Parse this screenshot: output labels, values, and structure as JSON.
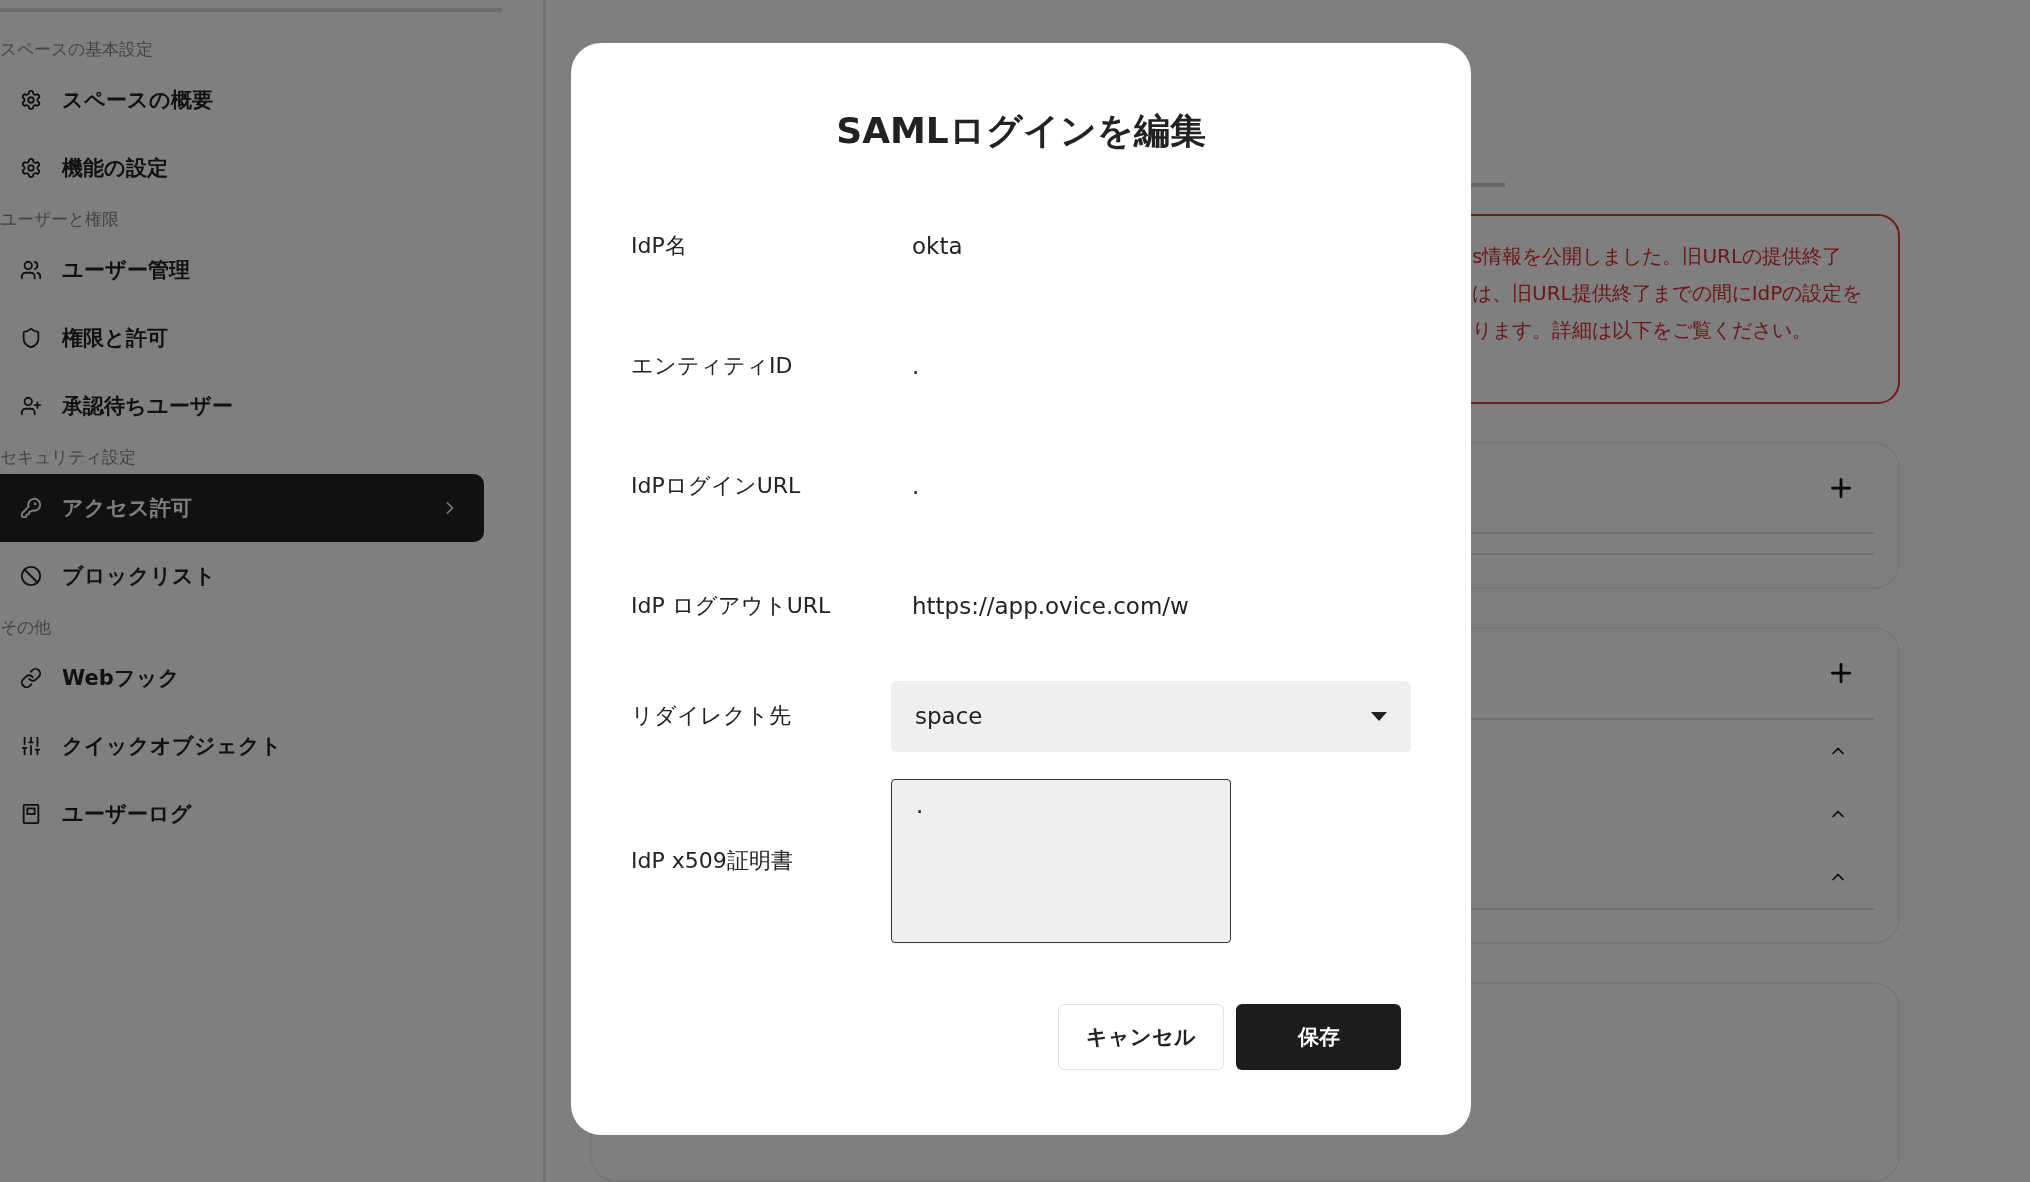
{
  "sidebar": {
    "sections": [
      {
        "heading": "スペースの基本設定",
        "items": [
          {
            "label": "スペースの概要",
            "selected": false
          },
          {
            "label": "機能の設定",
            "selected": false
          }
        ]
      },
      {
        "heading": "ユーザーと権限",
        "items": [
          {
            "label": "ユーザー管理",
            "selected": false
          },
          {
            "label": "権限と許可",
            "selected": false
          },
          {
            "label": "承認待ちユーザー",
            "selected": false
          }
        ]
      },
      {
        "heading": "セキュリティ設定",
        "items": [
          {
            "label": "アクセス許可",
            "selected": true
          },
          {
            "label": "ブロックリスト",
            "selected": false
          }
        ]
      },
      {
        "heading": "その他",
        "items": [
          {
            "label": "Webフック",
            "selected": false
          },
          {
            "label": "クイックオブジェクト",
            "selected": false
          },
          {
            "label": "ユーザーログ",
            "selected": false
          }
        ]
      }
    ]
  },
  "main": {
    "alert": {
      "lines": [
        "s情報を公開しました。旧URLの提供終了",
        "は、旧URL提供終了までの間にIdPの設定を",
        "ります。詳細は以下をご覧ください。"
      ]
    },
    "cards": [
      {
        "kind": "add"
      },
      {
        "kind": "add",
        "rows": [
          {
            "expanded": true
          },
          {
            "expanded": true
          },
          {
            "expanded": true
          }
        ]
      },
      {
        "kind": "plain"
      }
    ]
  },
  "dialog": {
    "title": "SAMLログインを編集",
    "fields": [
      {
        "kind": "text",
        "label": "IdP名",
        "value": "okta"
      },
      {
        "kind": "text",
        "label": "エンティティID",
        "value": "."
      },
      {
        "kind": "text",
        "label": "IdPログインURL",
        "value": "."
      },
      {
        "kind": "text",
        "label": "IdP ログアウトURL",
        "value": "https://app.ovice.com/w"
      },
      {
        "kind": "select",
        "label": "リダイレクト先",
        "value": "space"
      },
      {
        "kind": "textarea",
        "label": "IdP x509証明書",
        "value": "."
      }
    ],
    "buttons": [
      {
        "label": "キャンセル",
        "kind": "secondary"
      },
      {
        "label": "保存",
        "kind": "primary"
      }
    ]
  }
}
